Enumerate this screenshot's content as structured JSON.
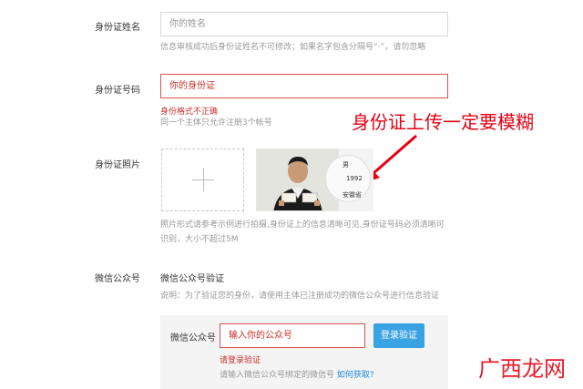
{
  "form": {
    "name": {
      "label": "身份证姓名",
      "placeholder": "你的姓名",
      "hint": "信息审核成功后身份证姓名不可修改；如果名字包含分隔号“·”，请勿忽略"
    },
    "id_number": {
      "label": "身份证号码",
      "placeholder": "你的身份证",
      "error": "身份格式不正确",
      "hint": "同一个主体只允许注册3个帐号"
    },
    "photo": {
      "label": "身份证照片",
      "hint_line1": "照片形式请参考示例进行拍摄,身份证上的信息清晰可见,身份证号码必须清晰可",
      "hint_line2": "识别，大小不超过5M",
      "sample_magnifier": [
        "男",
        "1992",
        "安徽省"
      ]
    },
    "wechat": {
      "label": "微信公众号",
      "title": "微信公众号验证",
      "description": "说明：为了验证您的身份，请使用主体已注册成功的微信公众号进行信息验证",
      "input_label": "微信公众号",
      "input_placeholder": "输入你的公众号",
      "button": "登录验证",
      "error": "请登录验证",
      "hint": "请输入微信公众号绑定的微信号",
      "link": "如何获取?"
    }
  },
  "annotation": "身份证上传一定要模糊",
  "watermark": "广西龙网",
  "colors": {
    "annotation_red": "#e60012",
    "error_red": "#c9302c",
    "button_blue": "#3aa3e4",
    "link_blue": "#1e88e5"
  }
}
